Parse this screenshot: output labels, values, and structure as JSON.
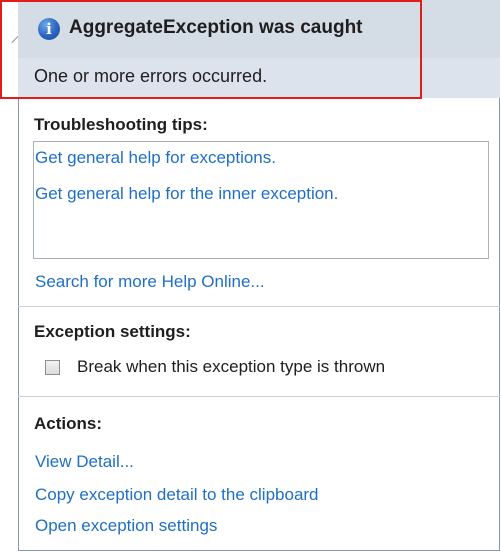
{
  "header": {
    "title": "AggregateException was caught",
    "message": "One or more errors occurred."
  },
  "troubleshooting": {
    "label": "Troubleshooting tips:",
    "tips": [
      "Get general help for exceptions.",
      "Get general help for the inner exception."
    ],
    "search_link": "Search for more Help Online..."
  },
  "exception_settings": {
    "label": "Exception settings:",
    "checkbox_label": "Break when this exception type is thrown",
    "checked": false
  },
  "actions": {
    "label": "Actions:",
    "items": [
      "View Detail...",
      "Copy exception detail to the clipboard",
      "Open exception settings"
    ]
  },
  "icons": {
    "header_icon": "info-icon"
  },
  "colors": {
    "link": "#1f6fc5",
    "header_bg": "#d4dce6",
    "highlight": "#e21b1b"
  }
}
